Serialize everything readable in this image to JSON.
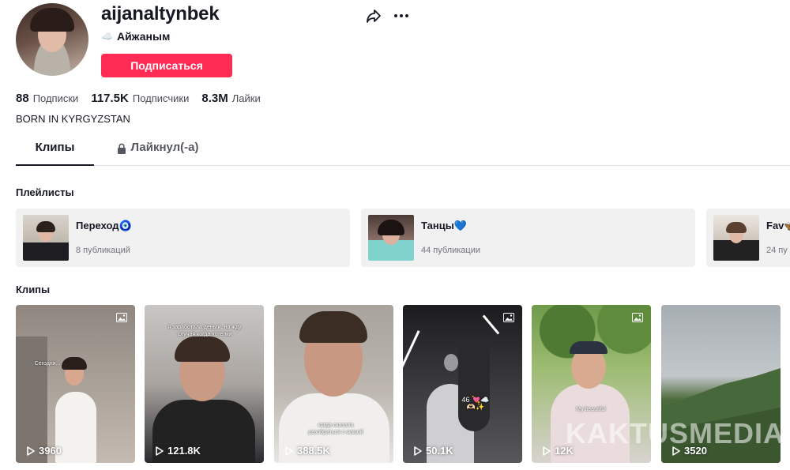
{
  "profile": {
    "username": "aijanaltynbek",
    "nickname_icon": "☁️",
    "nickname": "Айжаным",
    "follow_label": "Подписаться",
    "bio": "BORN IN KYRGYZSTAN"
  },
  "stats": {
    "following_value": "88",
    "following_label": "Подписки",
    "followers_value": "117.5K",
    "followers_label": "Подписчики",
    "likes_value": "8.3M",
    "likes_label": "Лайки"
  },
  "tabs": {
    "clips_label": "Клипы",
    "liked_label": "Лайкнул(-а)"
  },
  "playlists": {
    "title": "Плейлисты",
    "items": [
      {
        "title": "Переход🧿",
        "count": "8 публикаций"
      },
      {
        "title": "Танцы💙",
        "count": "44 публикации"
      },
      {
        "title": "Fav🦋",
        "count": "24 пу"
      }
    ]
  },
  "clips": {
    "title": "Клипы",
    "items": [
      {
        "views": "3960",
        "caption": "Сегодня..."
      },
      {
        "views": "121.8K",
        "caption": "я заработала деньги, но жду случая когда хотелки"
      },
      {
        "views": "388.5K",
        "caption": "когда сказала разобраться с мамой"
      },
      {
        "views": "50.1K",
        "caption": "46 💘☁️🫶🏻✨"
      },
      {
        "views": "12K",
        "caption": "My beautiful"
      },
      {
        "views": "3520",
        "caption": ""
      }
    ]
  },
  "watermark": "KAKTUSMEDIA",
  "colors": {
    "accent": "#fe2c55",
    "text": "#161823",
    "muted": "#73747b",
    "card_bg": "#f1f1f2"
  }
}
